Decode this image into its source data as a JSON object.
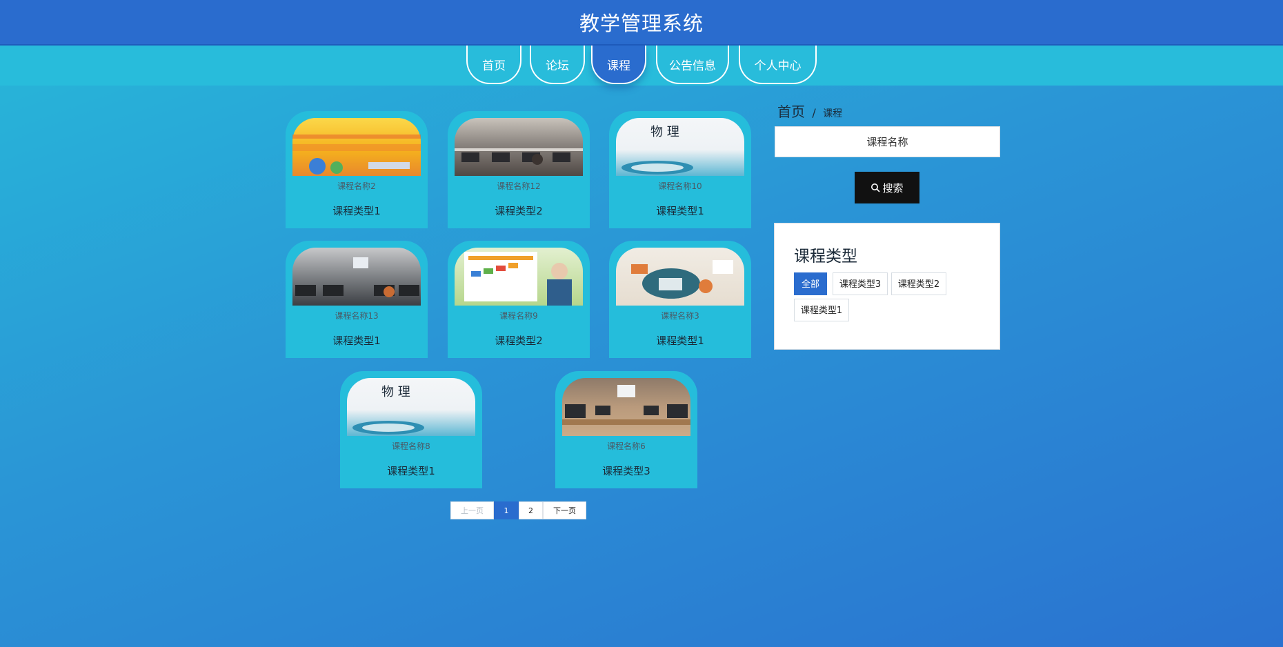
{
  "header": {
    "title": "教学管理系统"
  },
  "nav": [
    {
      "label": "首页",
      "active": false
    },
    {
      "label": "论坛",
      "active": false
    },
    {
      "label": "课程",
      "active": true
    },
    {
      "label": "公告信息",
      "active": false
    },
    {
      "label": "个人中心",
      "active": false
    }
  ],
  "courses": [
    {
      "name": "课程名称2",
      "type": "课程类型1",
      "image": "yellow-textbook-cover"
    },
    {
      "name": "课程名称12",
      "type": "课程类型2",
      "image": "computer-lab-photo"
    },
    {
      "name": "课程名称10",
      "type": "课程类型1",
      "image": "physics-textbook-cover"
    },
    {
      "name": "课程名称13",
      "type": "课程类型1",
      "image": "computer-lab-photo"
    },
    {
      "name": "课程名称9",
      "type": "课程类型2",
      "image": "lecture-slide-with-teacher"
    },
    {
      "name": "课程名称3",
      "type": "课程类型1",
      "image": "office-desk-illustration"
    },
    {
      "name": "课程名称8",
      "type": "课程类型1",
      "image": "physics-textbook-cover"
    },
    {
      "name": "课程名称6",
      "type": "课程类型3",
      "image": "classroom-computers-photo"
    }
  ],
  "pagination": {
    "prev": "上一页",
    "pages": [
      "1",
      "2"
    ],
    "current": "1",
    "next": "下一页"
  },
  "breadcrumb": {
    "home": "首页",
    "separator": "/",
    "current": "课程"
  },
  "search": {
    "placeholder": "课程名称",
    "button": "搜索"
  },
  "category_panel": {
    "title": "课程类型",
    "tags": [
      {
        "label": "全部",
        "active": true
      },
      {
        "label": "课程类型3",
        "active": false
      },
      {
        "label": "课程类型2",
        "active": false
      },
      {
        "label": "课程类型1",
        "active": false
      }
    ]
  },
  "colors": {
    "header": "#2a6cce",
    "nav_bar": "#28bcdb",
    "card": "#25bddb",
    "accent": "#2a6cce",
    "search_button": "#111111"
  }
}
